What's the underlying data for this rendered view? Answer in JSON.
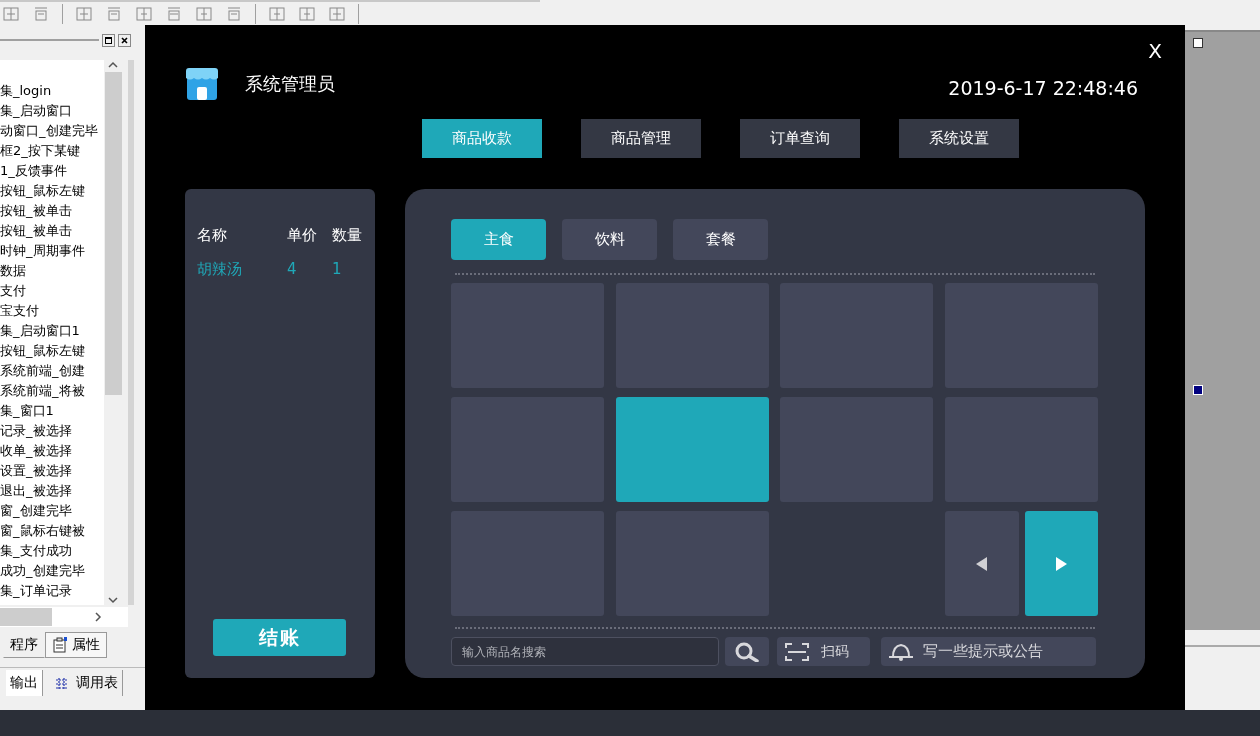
{
  "ide": {
    "event_list": [
      "集_login",
      "集_启动窗口",
      "动窗口_创建完毕",
      "框2_按下某键",
      "1_反馈事件",
      "按钮_鼠标左键",
      "按钮_被单击",
      "按钮_被单击",
      "时钟_周期事件",
      "数据",
      "支付",
      "宝支付",
      "集_启动窗口1",
      "按钮_鼠标左键",
      "系统前端_创建",
      "系统前端_将被",
      "集_窗口1",
      "记录_被选择",
      "收单_被选择",
      "设置_被选择",
      "退出_被选择",
      "窗_创建完毕",
      "窗_鼠标右键被",
      "集_支付成功",
      "成功_创建完毕",
      "集_订单记录"
    ],
    "panel_tabs": [
      {
        "label": "程序",
        "selected": true
      },
      {
        "label": "属性",
        "selected": false
      }
    ],
    "output_tabs": [
      {
        "label": "输出",
        "selected": true
      },
      {
        "label": "调用表",
        "selected": false
      }
    ]
  },
  "app": {
    "close": "X",
    "user": "系统管理员",
    "datetime": "2019-6-17 22:48:46",
    "nav_tabs": [
      {
        "label": "商品收款",
        "selected": true
      },
      {
        "label": "商品管理",
        "selected": false
      },
      {
        "label": "订单查询",
        "selected": false
      },
      {
        "label": "系统设置",
        "selected": false
      }
    ],
    "cart": {
      "columns": [
        "名称",
        "单价",
        "数量"
      ],
      "rows": [
        {
          "name": "胡辣汤",
          "price": "4",
          "qty": "1"
        }
      ],
      "checkout": "结账"
    },
    "category_tabs": [
      {
        "label": "主食",
        "selected": true
      },
      {
        "label": "饮料",
        "selected": false
      },
      {
        "label": "套餐",
        "selected": false
      }
    ],
    "products": [
      {
        "selected": false
      },
      {
        "selected": false
      },
      {
        "selected": false
      },
      {
        "selected": false
      },
      {
        "selected": false
      },
      {
        "selected": true
      },
      {
        "selected": false
      },
      {
        "selected": false
      },
      {
        "selected": false
      },
      {
        "selected": false
      }
    ],
    "search": {
      "placeholder": "输入商品名搜索"
    },
    "scan": "扫码",
    "notice": "写一些提示或公告"
  }
}
